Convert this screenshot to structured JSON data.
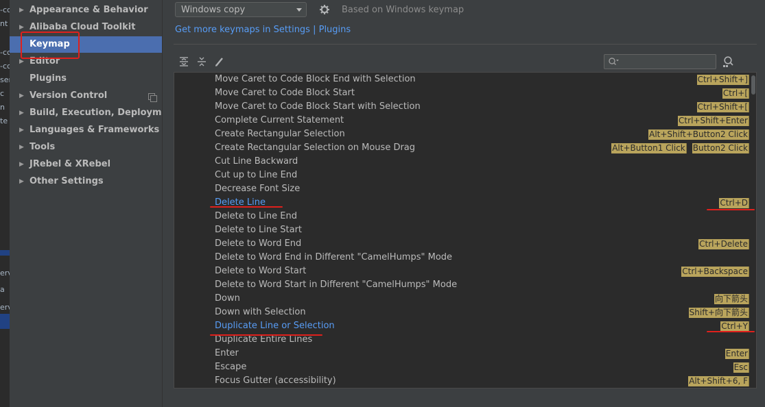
{
  "sidebar": {
    "items": [
      {
        "label": "Appearance & Behavior",
        "expandable": true,
        "selected": false
      },
      {
        "label": "Alibaba Cloud Toolkit",
        "expandable": true,
        "selected": false
      },
      {
        "label": "Keymap",
        "expandable": false,
        "selected": true
      },
      {
        "label": "Editor",
        "expandable": true,
        "selected": false
      },
      {
        "label": "Plugins",
        "expandable": false,
        "selected": false
      },
      {
        "label": "Version Control",
        "expandable": true,
        "selected": false
      },
      {
        "label": "Build, Execution, Deployment",
        "expandable": true,
        "selected": false
      },
      {
        "label": "Languages & Frameworks",
        "expandable": true,
        "selected": false
      },
      {
        "label": "Tools",
        "expandable": true,
        "selected": false
      },
      {
        "label": "JRebel & XRebel",
        "expandable": true,
        "selected": false
      },
      {
        "label": "Other Settings",
        "expandable": true,
        "selected": false
      }
    ]
  },
  "keymap": {
    "selected": "Windows copy",
    "based_on": "Based on Windows keymap",
    "get_more_link": "Get more keymaps in Settings | Plugins"
  },
  "search": {
    "placeholder": "",
    "value": ""
  },
  "actions": [
    {
      "name": "Move Caret to Code Block End with Selection",
      "shortcuts": [
        "Ctrl+Shift+]"
      ]
    },
    {
      "name": "Move Caret to Code Block Start",
      "shortcuts": [
        "Ctrl+["
      ]
    },
    {
      "name": "Move Caret to Code Block Start with Selection",
      "shortcuts": [
        "Ctrl+Shift+["
      ]
    },
    {
      "name": "Complete Current Statement",
      "shortcuts": [
        "Ctrl+Shift+Enter"
      ]
    },
    {
      "name": "Create Rectangular Selection",
      "shortcuts": [
        "Alt+Shift+Button2 Click"
      ]
    },
    {
      "name": "Create Rectangular Selection on Mouse Drag",
      "shortcuts": [
        "Alt+Button1 Click",
        "Button2 Click"
      ]
    },
    {
      "name": "Cut Line Backward",
      "shortcuts": []
    },
    {
      "name": "Cut up to Line End",
      "shortcuts": []
    },
    {
      "name": "Decrease Font Size",
      "shortcuts": []
    },
    {
      "name": "Delete Line",
      "shortcuts": [
        "Ctrl+D"
      ],
      "link": true
    },
    {
      "name": "Delete to Line End",
      "shortcuts": []
    },
    {
      "name": "Delete to Line Start",
      "shortcuts": []
    },
    {
      "name": "Delete to Word End",
      "shortcuts": [
        "Ctrl+Delete"
      ]
    },
    {
      "name": "Delete to Word End in Different \"CamelHumps\" Mode",
      "shortcuts": []
    },
    {
      "name": "Delete to Word Start",
      "shortcuts": [
        "Ctrl+Backspace"
      ]
    },
    {
      "name": "Delete to Word Start in Different \"CamelHumps\" Mode",
      "shortcuts": []
    },
    {
      "name": "Down",
      "shortcuts": [
        "向下箭头"
      ]
    },
    {
      "name": "Down with Selection",
      "shortcuts": [
        "Shift+向下箭头"
      ]
    },
    {
      "name": "Duplicate Line or Selection",
      "shortcuts": [
        "Ctrl+Y"
      ],
      "link": true
    },
    {
      "name": "Duplicate Entire Lines",
      "shortcuts": []
    },
    {
      "name": "Enter",
      "shortcuts": [
        "Enter"
      ]
    },
    {
      "name": "Escape",
      "shortcuts": [
        "Esc"
      ]
    },
    {
      "name": "Focus Gutter (accessibility)",
      "shortcuts": [
        "Alt+Shift+6, F"
      ]
    }
  ],
  "icons": {
    "gear": "gear-icon",
    "expand_all": "expand-all-icon",
    "collapse_all": "collapse-all-icon",
    "edit": "pencil-icon",
    "search": "search-icon",
    "find_shortcut": "find-by-shortcut-icon"
  },
  "colors": {
    "selection": "#4b6eaf",
    "link": "#589df6",
    "shortcut_chip": "#b9a45c",
    "annotation_red": "#e0201c"
  }
}
